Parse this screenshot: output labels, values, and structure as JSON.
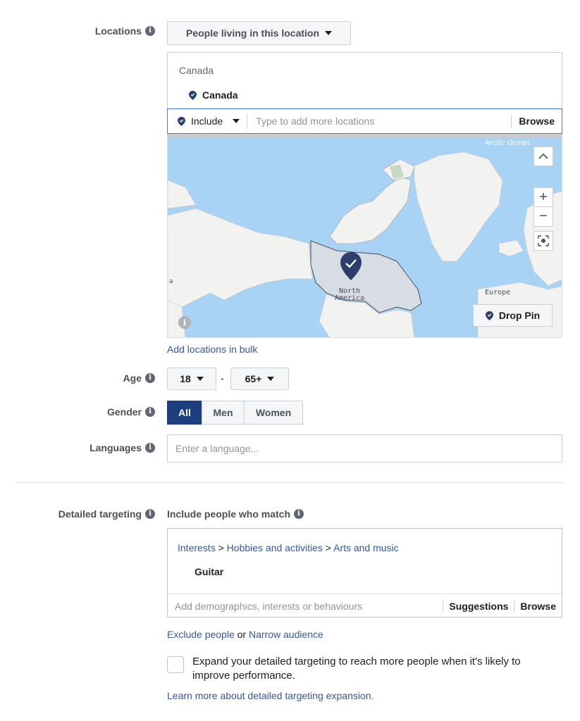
{
  "locations": {
    "label": "Locations",
    "mode_button": "People living in this location",
    "group_header": "Canada",
    "selected_item": "Canada",
    "include_label": "Include",
    "search_placeholder": "Type to add more locations",
    "browse_label": "Browse",
    "map": {
      "ocean_label": "Arctic Ocean",
      "region_label_line1": "North",
      "region_label_line2": "America",
      "europe_label": "Europe",
      "edge_label": "a",
      "zoom_in": "+",
      "zoom_out": "−",
      "drop_pin_label": "Drop Pin"
    },
    "bulk_link": "Add locations in bulk"
  },
  "age": {
    "label": "Age",
    "min": "18",
    "separator": "-",
    "max": "65+"
  },
  "gender": {
    "label": "Gender",
    "options": [
      "All",
      "Men",
      "Women"
    ],
    "selected": "All"
  },
  "languages": {
    "label": "Languages",
    "placeholder": "Enter a language..."
  },
  "detailed_targeting": {
    "label": "Detailed targeting",
    "include_heading": "Include people who match",
    "path": {
      "level1": "Interests",
      "sep": ">",
      "level2": "Hobbies and activities",
      "level3": "Arts and music"
    },
    "selected_item": "Guitar",
    "search_placeholder": "Add demographics, interests or behaviours",
    "suggestions_label": "Suggestions",
    "browse_label": "Browse",
    "exclude_link": "Exclude people",
    "or_text": "or",
    "narrow_link": "Narrow audience",
    "expand_text_line1": "Expand your detailed targeting to reach more people when it's likely to",
    "expand_text_line2": "improve performance.",
    "learn_more_link": "Learn more about detailed targeting expansion."
  },
  "colors": {
    "accent": "#1d3f80",
    "link": "#365899",
    "focus_border": "#4080ff",
    "map_water": "#a9d3f5",
    "map_land": "#f2f2f0",
    "pin": "#2c3e6b"
  }
}
